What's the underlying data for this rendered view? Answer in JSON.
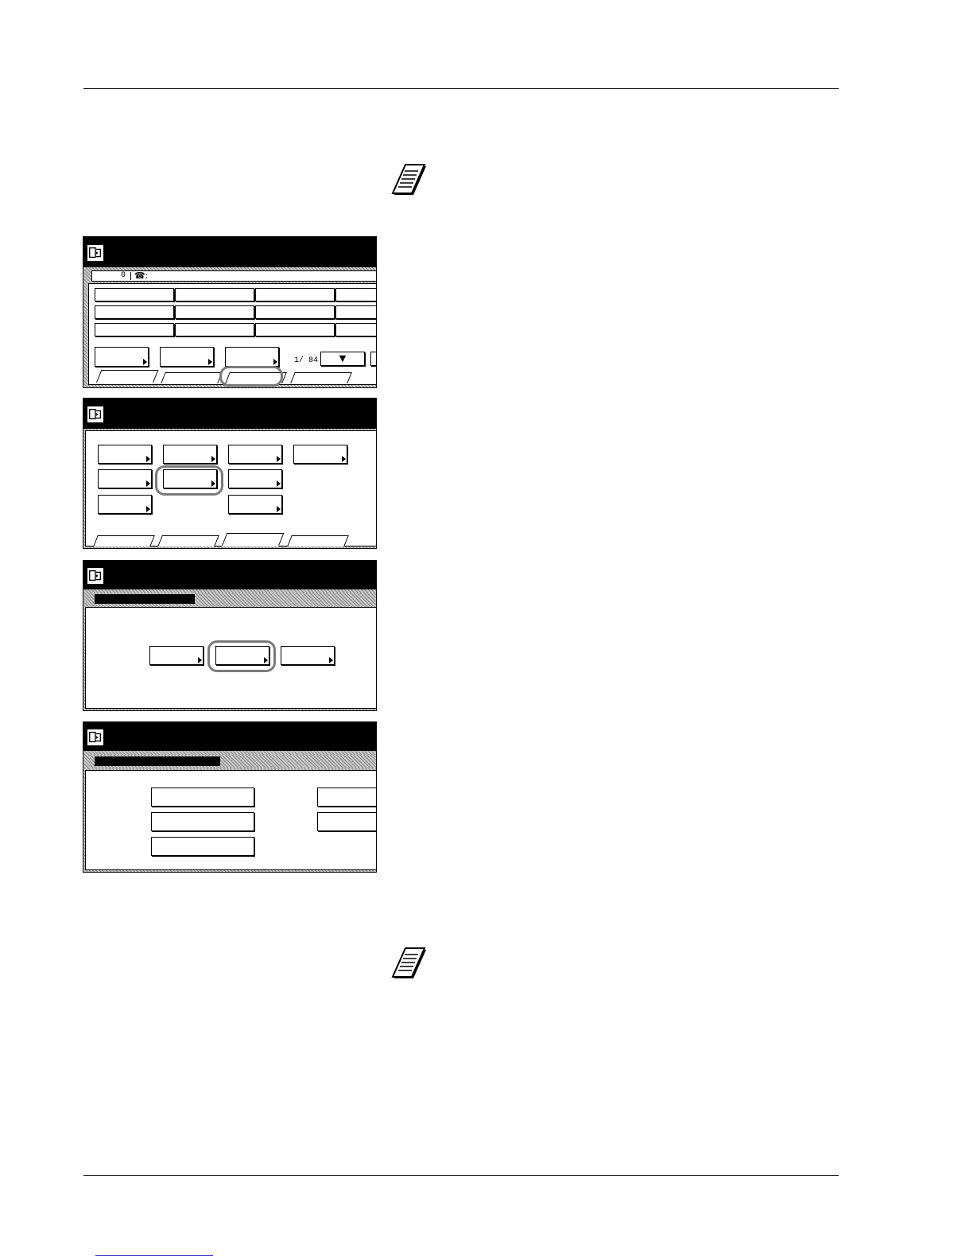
{
  "screen1": {
    "dial_field": {
      "value": "0",
      "tel_glyph": "☎:"
    },
    "page_indicator": "1/ 84",
    "scroll_down_glyph": "▼",
    "highlighted_tab_index": 2
  },
  "screen2": {
    "highlighted_key": "row-2-col-2",
    "active_tab_index": 2
  },
  "screen3": {
    "highlighted_key": "middle"
  },
  "screen4": {},
  "icons": {
    "note": "note-page-icon",
    "copy_mode": "copy-mode-icon",
    "telephone": "telephone-icon",
    "scroll_down": "down-arrow-icon"
  }
}
